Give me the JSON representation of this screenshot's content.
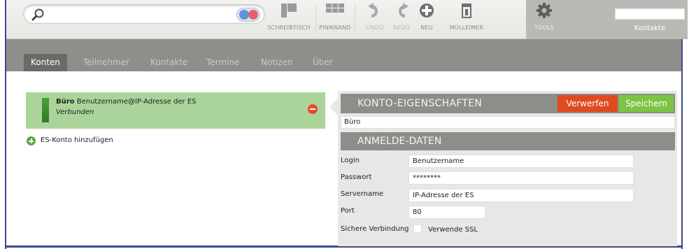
{
  "toolbar": {
    "buttons": [
      {
        "label": "SCHREIBTISCH",
        "icon": "desktop-icon"
      },
      {
        "label": "PINNWAND",
        "icon": "pinboard-icon"
      },
      {
        "label": "UNDO",
        "icon": "undo-icon"
      },
      {
        "label": "REDO",
        "icon": "redo-icon"
      },
      {
        "label": "NEU",
        "icon": "plus-circle-icon"
      },
      {
        "label": "MÜLLEIMER",
        "icon": "trash-icon"
      },
      {
        "label": "TOOLS",
        "icon": "gear-icon"
      }
    ],
    "kontakte_label": "Kontakte"
  },
  "nav": {
    "tabs": [
      "Konten",
      "Teilnehmer",
      "Kontakte",
      "Termine",
      "Notizen",
      "Über"
    ],
    "active": "Konten"
  },
  "accounts": [
    {
      "name": "Büro",
      "address": "Benutzername@IP-Adresse der ES",
      "status": "Verbunden"
    }
  ],
  "add_account_label": "ES-Konto hinzufügen",
  "panel": {
    "title": "KONTO-EIGENSCHAFTEN",
    "discard_label": "Verwerfen",
    "save_label": "Speichern",
    "account_name": "Büro",
    "section_title": "ANMELDE-DATEN",
    "fields": {
      "login": {
        "label": "Login",
        "value": "Benutzername"
      },
      "password": {
        "label": "Passwort",
        "value": "********"
      },
      "servername": {
        "label": "Servername",
        "value": "IP-Adresse der ES"
      },
      "port": {
        "label": "Port",
        "value": "80"
      },
      "secure": {
        "label": "Sichere Verbindung",
        "option": "Verwende SSL",
        "checked": false
      }
    }
  },
  "colors": {
    "frame": "#3b4a86",
    "nav_bg": "#8e8e8a",
    "selected_row": "#abd49a",
    "discard": "#e04a1f",
    "save": "#7dc443"
  }
}
